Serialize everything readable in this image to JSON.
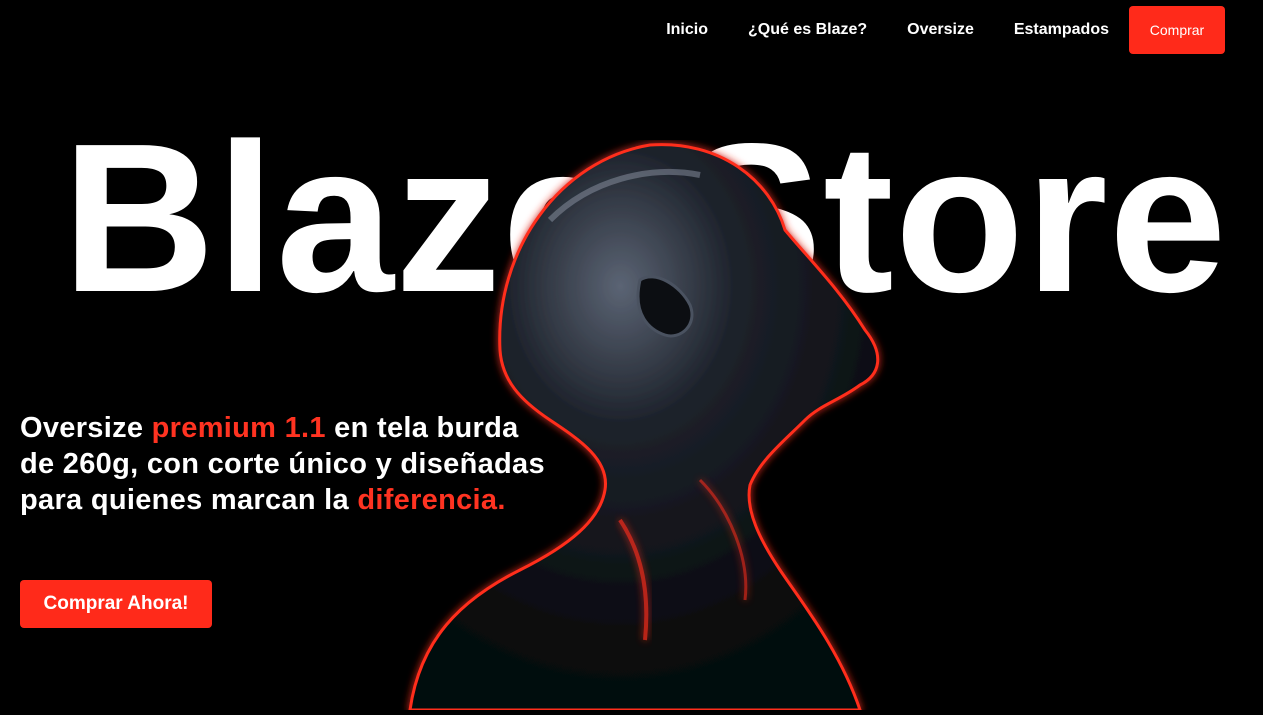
{
  "nav": {
    "items": [
      {
        "label": "Inicio"
      },
      {
        "label": "¿Qué es Blaze?"
      },
      {
        "label": "Oversize"
      },
      {
        "label": "Estampados"
      }
    ],
    "cta_label": "Comprar"
  },
  "hero": {
    "title": "Blaze Store",
    "tagline": {
      "part1": "Oversize ",
      "highlight1": "premium 1.1",
      "part2": " en tela burda de 260g, con corte único y diseñadas para quienes marcan la ",
      "highlight2": "diferencia."
    },
    "cta_label": "Comprar Ahora!"
  },
  "colors": {
    "accent": "#ff2a1a",
    "background": "#000000",
    "text": "#ffffff"
  },
  "icons": {
    "hero_image": "mannequin-head-figure"
  }
}
